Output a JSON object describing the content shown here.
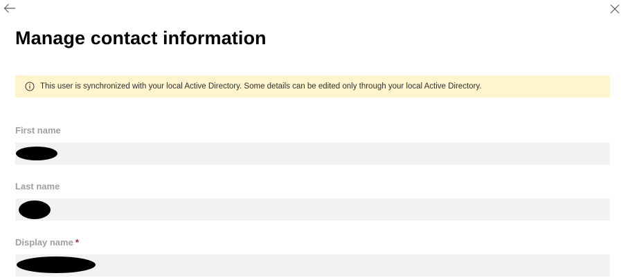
{
  "header": {
    "title": "Manage contact information",
    "back_icon": "arrow-left-icon",
    "close_icon": "close-icon"
  },
  "banner": {
    "icon": "info-icon",
    "text": "This user is synchronized with your local Active Directory. Some details can be edited only through your local Active Directory.",
    "background": "#fff4ce"
  },
  "form": {
    "first_name": {
      "label": "First name"
    },
    "last_name": {
      "label": "Last name"
    },
    "display_name": {
      "label": "Display name",
      "required_marker": "*"
    }
  },
  "colors": {
    "disabled_label": "#a19f9d",
    "disabled_field": "#f3f2f1",
    "required": "#a4262c"
  }
}
